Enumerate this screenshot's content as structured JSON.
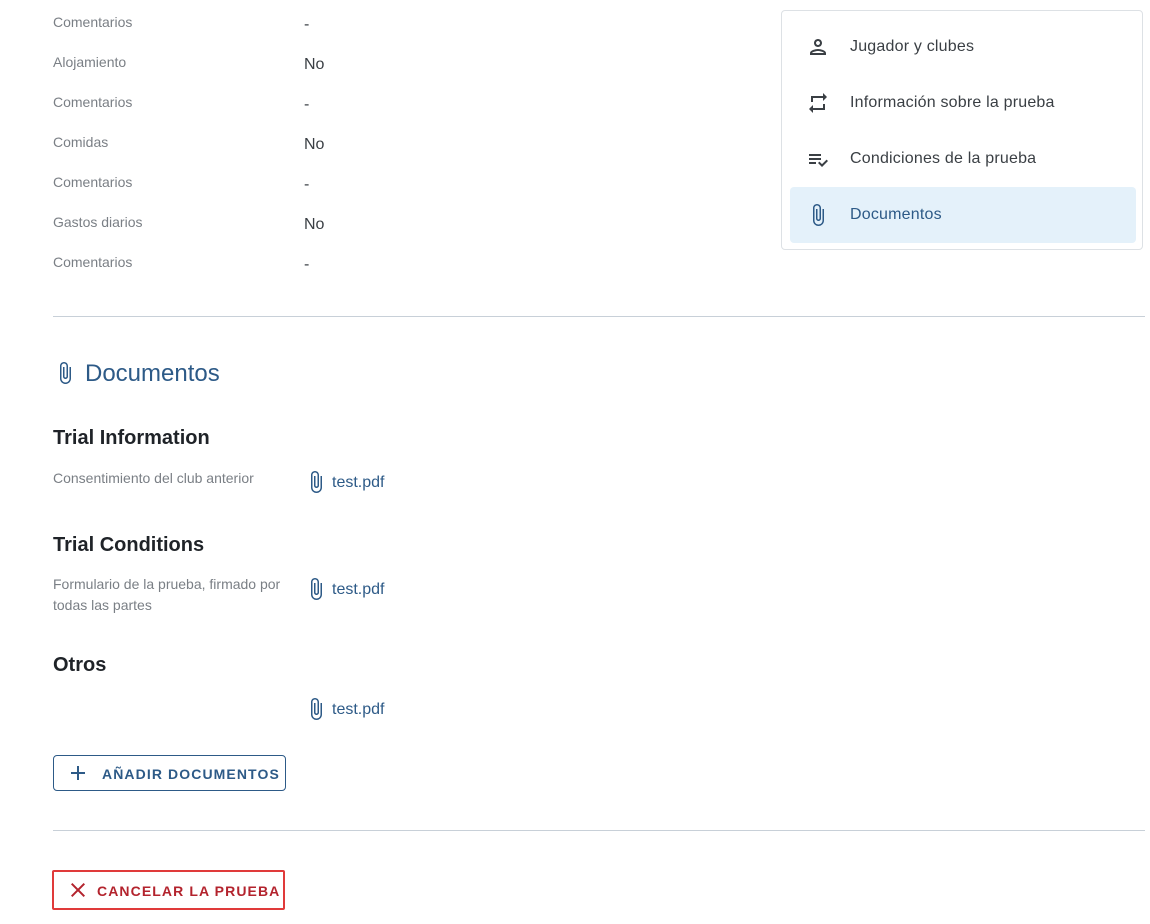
{
  "colors": {
    "accent": "#2d5a87",
    "active_nav_bg": "#e4f1fa",
    "label_gray": "#7a7f85",
    "text_dark": "#1f2328",
    "danger": "#b3232d",
    "highlight_border": "#e03a3a",
    "divider": "#c8d0d8"
  },
  "details": [
    {
      "label": "Comentarios",
      "value": "-"
    },
    {
      "label": "Alojamiento",
      "value": "No"
    },
    {
      "label": "Comentarios",
      "value": "-"
    },
    {
      "label": "Comidas",
      "value": "No"
    },
    {
      "label": "Comentarios",
      "value": "-"
    },
    {
      "label": "Gastos diarios",
      "value": "No"
    },
    {
      "label": "Comentarios",
      "value": "-"
    }
  ],
  "sidenav": {
    "items": [
      {
        "label": "Jugador y clubes",
        "icon": "person-icon",
        "active": false
      },
      {
        "label": "Información sobre la prueba",
        "icon": "swap-icon",
        "active": false
      },
      {
        "label": "Condiciones de la prueba",
        "icon": "checklist-icon",
        "active": false
      },
      {
        "label": "Documentos",
        "icon": "paperclip-icon",
        "active": true
      }
    ]
  },
  "documents": {
    "title": "Documentos",
    "icon": "paperclip-icon",
    "groups": [
      {
        "title": "Trial Information",
        "label": "Consentimiento del club anterior",
        "file": "test.pdf"
      },
      {
        "title": "Trial Conditions",
        "label": "Formulario de la prueba, firmado por todas las partes",
        "file": "test.pdf"
      },
      {
        "title": "Otros",
        "label": "",
        "file": "test.pdf"
      }
    ],
    "add_button": "AÑADIR DOCUMENTOS"
  },
  "cancel_button": "CANCELAR LA PRUEBA"
}
